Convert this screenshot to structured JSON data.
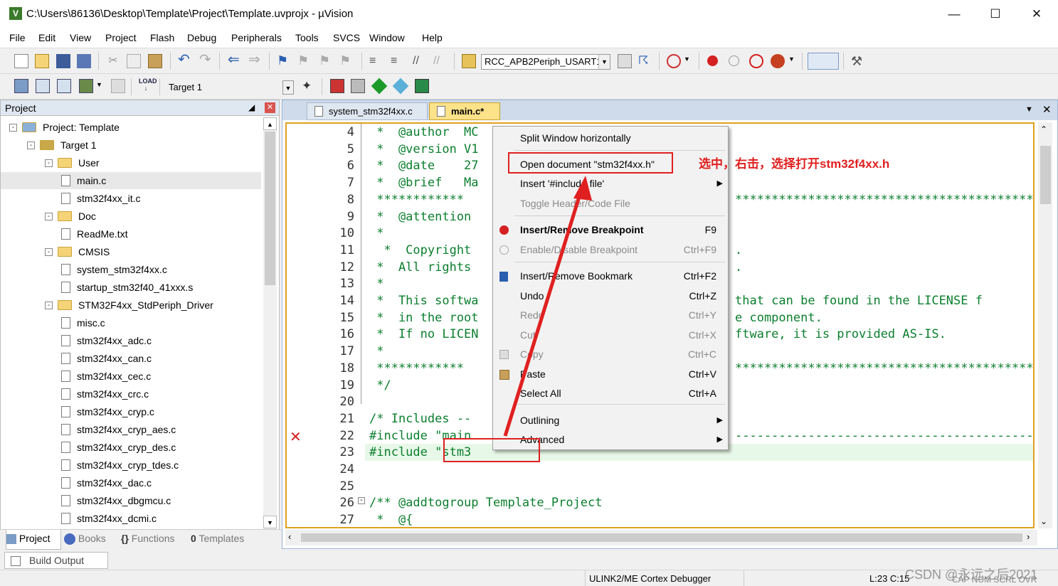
{
  "window": {
    "title": "C:\\Users\\86136\\Desktop\\Template\\Project\\Template.uvprojx - µVision"
  },
  "menu": [
    "File",
    "Edit",
    "View",
    "Project",
    "Flash",
    "Debug",
    "Peripherals",
    "Tools",
    "SVCS",
    "Window",
    "Help"
  ],
  "toolbar": {
    "find_value": "RCC_APB2Periph_USART1",
    "target_value": "Target 1"
  },
  "project_panel": {
    "title": "Project",
    "tree": [
      "Project: Template",
      "Target 1",
      "User",
      "main.c",
      "stm32f4xx_it.c",
      "Doc",
      "ReadMe.txt",
      "CMSIS",
      "system_stm32f4xx.c",
      "startup_stm32f40_41xxx.s",
      "STM32F4xx_StdPeriph_Driver",
      "misc.c",
      "stm32f4xx_adc.c",
      "stm32f4xx_can.c",
      "stm32f4xx_cec.c",
      "stm32f4xx_crc.c",
      "stm32f4xx_cryp.c",
      "stm32f4xx_cryp_aes.c",
      "stm32f4xx_cryp_des.c",
      "stm32f4xx_cryp_tdes.c",
      "stm32f4xx_dac.c",
      "stm32f4xx_dbgmcu.c",
      "stm32f4xx_dcmi.c"
    ],
    "tabs": [
      "Project",
      "Books",
      "Functions",
      "Templates"
    ]
  },
  "editor": {
    "tabs": [
      "system_stm32f4xx.c",
      "main.c*"
    ],
    "line_numbers": [
      "4",
      "5",
      "6",
      "7",
      "8",
      "9",
      "10",
      "11",
      "12",
      "13",
      "14",
      "15",
      "16",
      "17",
      "18",
      "19",
      "20",
      "21",
      "22",
      "23",
      "24",
      "25",
      "26",
      "27"
    ],
    "code": [
      " *  @author  MC",
      " *  @version V1",
      " *  @date    27",
      " *  @brief   Ma",
      " ************",
      " *  @attention",
      "",
      " * ",
      "  *  Copyright",
      " *  All rights",
      " * ",
      " *  This softwa",
      " *  in the root",
      " *  If no LICEN",
      " * ",
      " ************",
      " */",
      "",
      "/* Includes --",
      "#include \"main",
      "#include \"stm3",
      "",
      "",
      "/** @addtogroup Template_Project",
      " *  @{"
    ],
    "code_right": [
      "",
      "",
      "",
      "",
      "************************************************",
      "",
      "",
      ".",
      ".",
      "",
      "that can be found in the LICENSE f",
      "e component.",
      "ftware, it is provided AS-IS.",
      "",
      "************************************************",
      "",
      "",
      "",
      "-----------------------------------------------",
      "",
      "",
      "",
      "",
      ""
    ]
  },
  "context_menu": [
    {
      "label": "Split Window horizontally",
      "shortcut": "",
      "sub": false,
      "disabled": false,
      "bold": false
    },
    {
      "label": "Open document \"stm32f4xx.h\"",
      "shortcut": "",
      "sub": false,
      "disabled": false,
      "bold": false
    },
    {
      "label": "Insert '#include file'",
      "shortcut": "",
      "sub": true,
      "disabled": false,
      "bold": false
    },
    {
      "label": "Toggle Header/Code File",
      "shortcut": "",
      "sub": false,
      "disabled": true,
      "bold": false
    },
    {
      "label": "Insert/Remove Breakpoint",
      "shortcut": "F9",
      "sub": false,
      "disabled": false,
      "bold": true
    },
    {
      "label": "Enable/Disable Breakpoint",
      "shortcut": "Ctrl+F9",
      "sub": false,
      "disabled": true,
      "bold": false
    },
    {
      "label": "Insert/Remove Bookmark",
      "shortcut": "Ctrl+F2",
      "sub": false,
      "disabled": false,
      "bold": false
    },
    {
      "label": "Undo",
      "shortcut": "Ctrl+Z",
      "sub": false,
      "disabled": false,
      "bold": false
    },
    {
      "label": "Redo",
      "shortcut": "Ctrl+Y",
      "sub": false,
      "disabled": true,
      "bold": false
    },
    {
      "label": "Cut",
      "shortcut": "Ctrl+X",
      "sub": false,
      "disabled": true,
      "bold": false
    },
    {
      "label": "Copy",
      "shortcut": "Ctrl+C",
      "sub": false,
      "disabled": true,
      "bold": false
    },
    {
      "label": "Paste",
      "shortcut": "Ctrl+V",
      "sub": false,
      "disabled": false,
      "bold": false
    },
    {
      "label": "Select All",
      "shortcut": "Ctrl+A",
      "sub": false,
      "disabled": false,
      "bold": false
    },
    {
      "label": "Outlining",
      "shortcut": "",
      "sub": true,
      "disabled": false,
      "bold": false
    },
    {
      "label": "Advanced",
      "shortcut": "",
      "sub": true,
      "disabled": false,
      "bold": false
    }
  ],
  "annotation": "选中，右击，选择打开stm32f4xx.h",
  "build_output": "Build Output",
  "status": {
    "debugger": "ULINK2/ME Cortex Debugger",
    "position": "L:23 C:15",
    "indicators": "CAP  NUM  SCRL  OVR"
  },
  "watermark": "CSDN @永远之后2021",
  "colors": {
    "accent": "#e02020",
    "code": "#0b7f2e",
    "selection": "#cfdbea"
  }
}
